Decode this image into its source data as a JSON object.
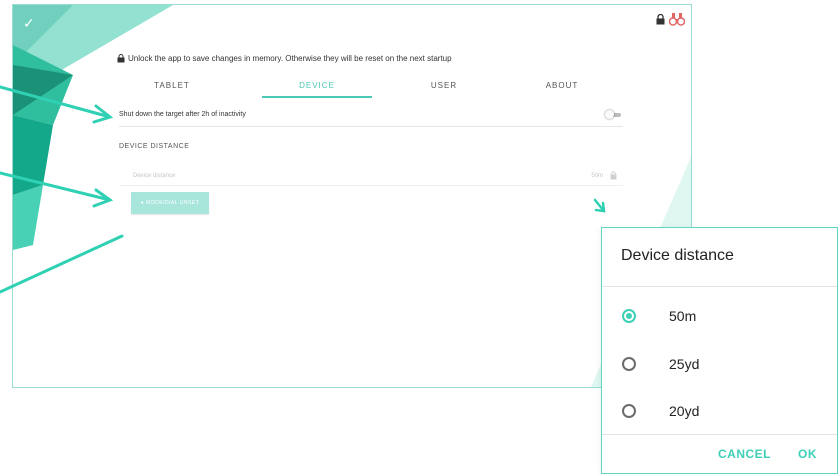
{
  "colors": {
    "accent": "#3dd0b6",
    "accent_light": "#a8e6dc",
    "frame_border": "#9adcd2",
    "lock_red": "#e06666"
  },
  "screen": {
    "banner": "Unlock the app to save changes in memory. Otherwise they will be reset on the next startup",
    "tabs": [
      {
        "label": "TABLET",
        "active": false
      },
      {
        "label": "DEVICE",
        "active": true
      },
      {
        "label": "USER",
        "active": false
      },
      {
        "label": "ABOUT",
        "active": false
      }
    ],
    "shutdown_label": "Shut down the target after 2h of inactivity",
    "shutdown_enabled": false,
    "section_title": "DEVICE DISTANCE",
    "distance_label": "Device distance",
    "distance_value": "50m",
    "unlock_button": "● MODE/DIAL UNSET"
  },
  "dialog": {
    "title": "Device distance",
    "options": [
      {
        "label": "50m",
        "checked": true
      },
      {
        "label": "25yd",
        "checked": false
      },
      {
        "label": "20yd",
        "checked": false
      }
    ],
    "cancel": "CANCEL",
    "ok": "OK"
  }
}
